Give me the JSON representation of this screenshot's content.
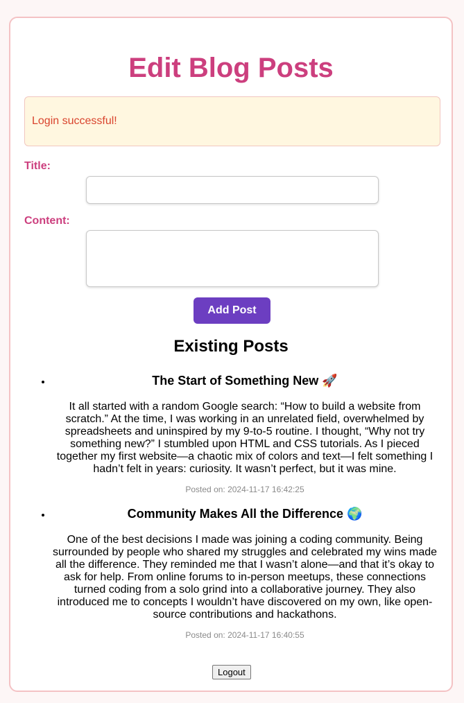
{
  "page": {
    "title": "Edit Blog Posts"
  },
  "alert": {
    "message": "Login successful!"
  },
  "form": {
    "title_label": "Title:",
    "title_value": "",
    "content_label": "Content:",
    "content_value": "",
    "submit_label": "Add Post"
  },
  "existing": {
    "heading": "Existing Posts",
    "posts": [
      {
        "title": "The Start of Something New 🚀",
        "content": "It all started with a random Google search: “How to build a website from scratch.” At the time, I was working in an unrelated field, overwhelmed by spreadsheets and uninspired by my 9-to-5 routine. I thought, “Why not try something new?” I stumbled upon HTML and CSS tutorials. As I pieced together my first website—a chaotic mix of colors and text—I felt something I hadn’t felt in years: curiosity. It wasn’t perfect, but it was mine.",
        "posted": "Posted on: 2024-11-17 16:42:25"
      },
      {
        "title": "Community Makes All the Difference 🌍",
        "content": "One of the best decisions I made was joining a coding community. Being surrounded by people who shared my struggles and celebrated my wins made all the difference. They reminded me that I wasn’t alone—and that it’s okay to ask for help. From online forums to in-person meetups, these connections turned coding from a solo grind into a collaborative journey. They also introduced me to concepts I wouldn’t have discovered on my own, like open-source contributions and hackathons.",
        "posted": "Posted on: 2024-11-17 16:40:55"
      }
    ]
  },
  "logout": {
    "label": "Logout"
  },
  "colors": {
    "accent": "#cc3f7e",
    "button": "#6c3ec1",
    "alert_bg": "#fff7e0",
    "alert_text": "#d9442e",
    "border": "#f4c2c4"
  }
}
